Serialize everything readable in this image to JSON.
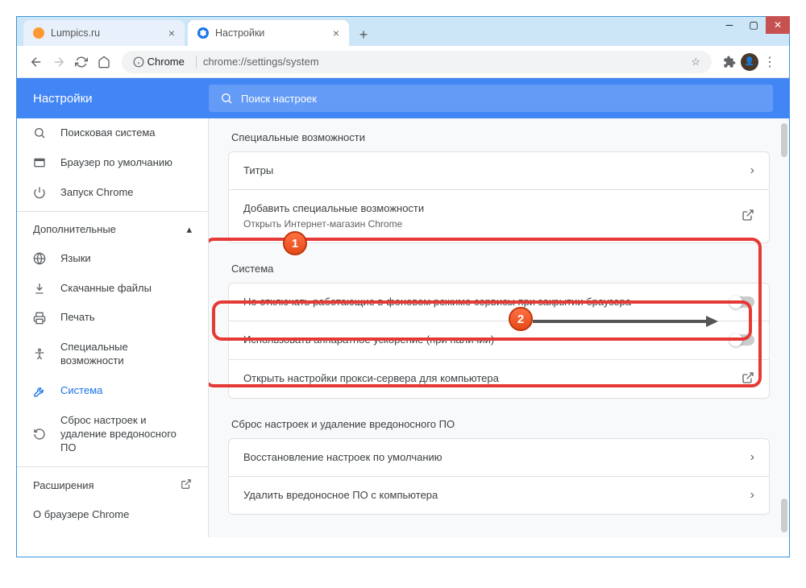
{
  "window": {
    "tabs": [
      {
        "title": "Lumpics.ru",
        "iconColor": "#ff9933"
      },
      {
        "title": "Настройки",
        "iconColor": "#1a73e8"
      }
    ],
    "omnibox": {
      "prefix": "Chrome",
      "url": "chrome://settings/system"
    }
  },
  "header": {
    "title": "Настройки",
    "searchPlaceholder": "Поиск настроек"
  },
  "sidebar": {
    "items": [
      {
        "icon": "search",
        "label": "Поисковая система"
      },
      {
        "icon": "browser",
        "label": "Браузер по умолчанию"
      },
      {
        "icon": "power",
        "label": "Запуск Chrome"
      }
    ],
    "advancedLabel": "Дополнительные",
    "advancedItems": [
      {
        "icon": "globe",
        "label": "Языки"
      },
      {
        "icon": "download",
        "label": "Скачанные файлы"
      },
      {
        "icon": "print",
        "label": "Печать"
      },
      {
        "icon": "accessibility",
        "label": "Специальные возможности"
      },
      {
        "icon": "wrench",
        "label": "Система",
        "active": true
      },
      {
        "icon": "reset",
        "label": "Сброс настроек и удаление вредоносного ПО"
      }
    ],
    "extensions": "Расширения",
    "about": "О браузере Chrome"
  },
  "page": {
    "accessibility": {
      "title": "Специальные возможности",
      "captions": "Титры",
      "addMore": "Добавить специальные возможности",
      "addMoreSub": "Открыть Интернет-магазин Chrome"
    },
    "system": {
      "title": "Система",
      "backgroundApps": "Не отключать работающие в фоновом режиме сервисы при закрытии браузера",
      "hwAccel": "Использовать аппаратное ускорение (при наличии)",
      "proxy": "Открыть настройки прокси-сервера для компьютера"
    },
    "reset": {
      "title": "Сброс настроек и удаление вредоносного ПО",
      "restore": "Восстановление настроек по умолчанию",
      "cleanup": "Удалить вредоносное ПО с компьютера"
    }
  },
  "annotations": {
    "badge1": "1",
    "badge2": "2"
  }
}
